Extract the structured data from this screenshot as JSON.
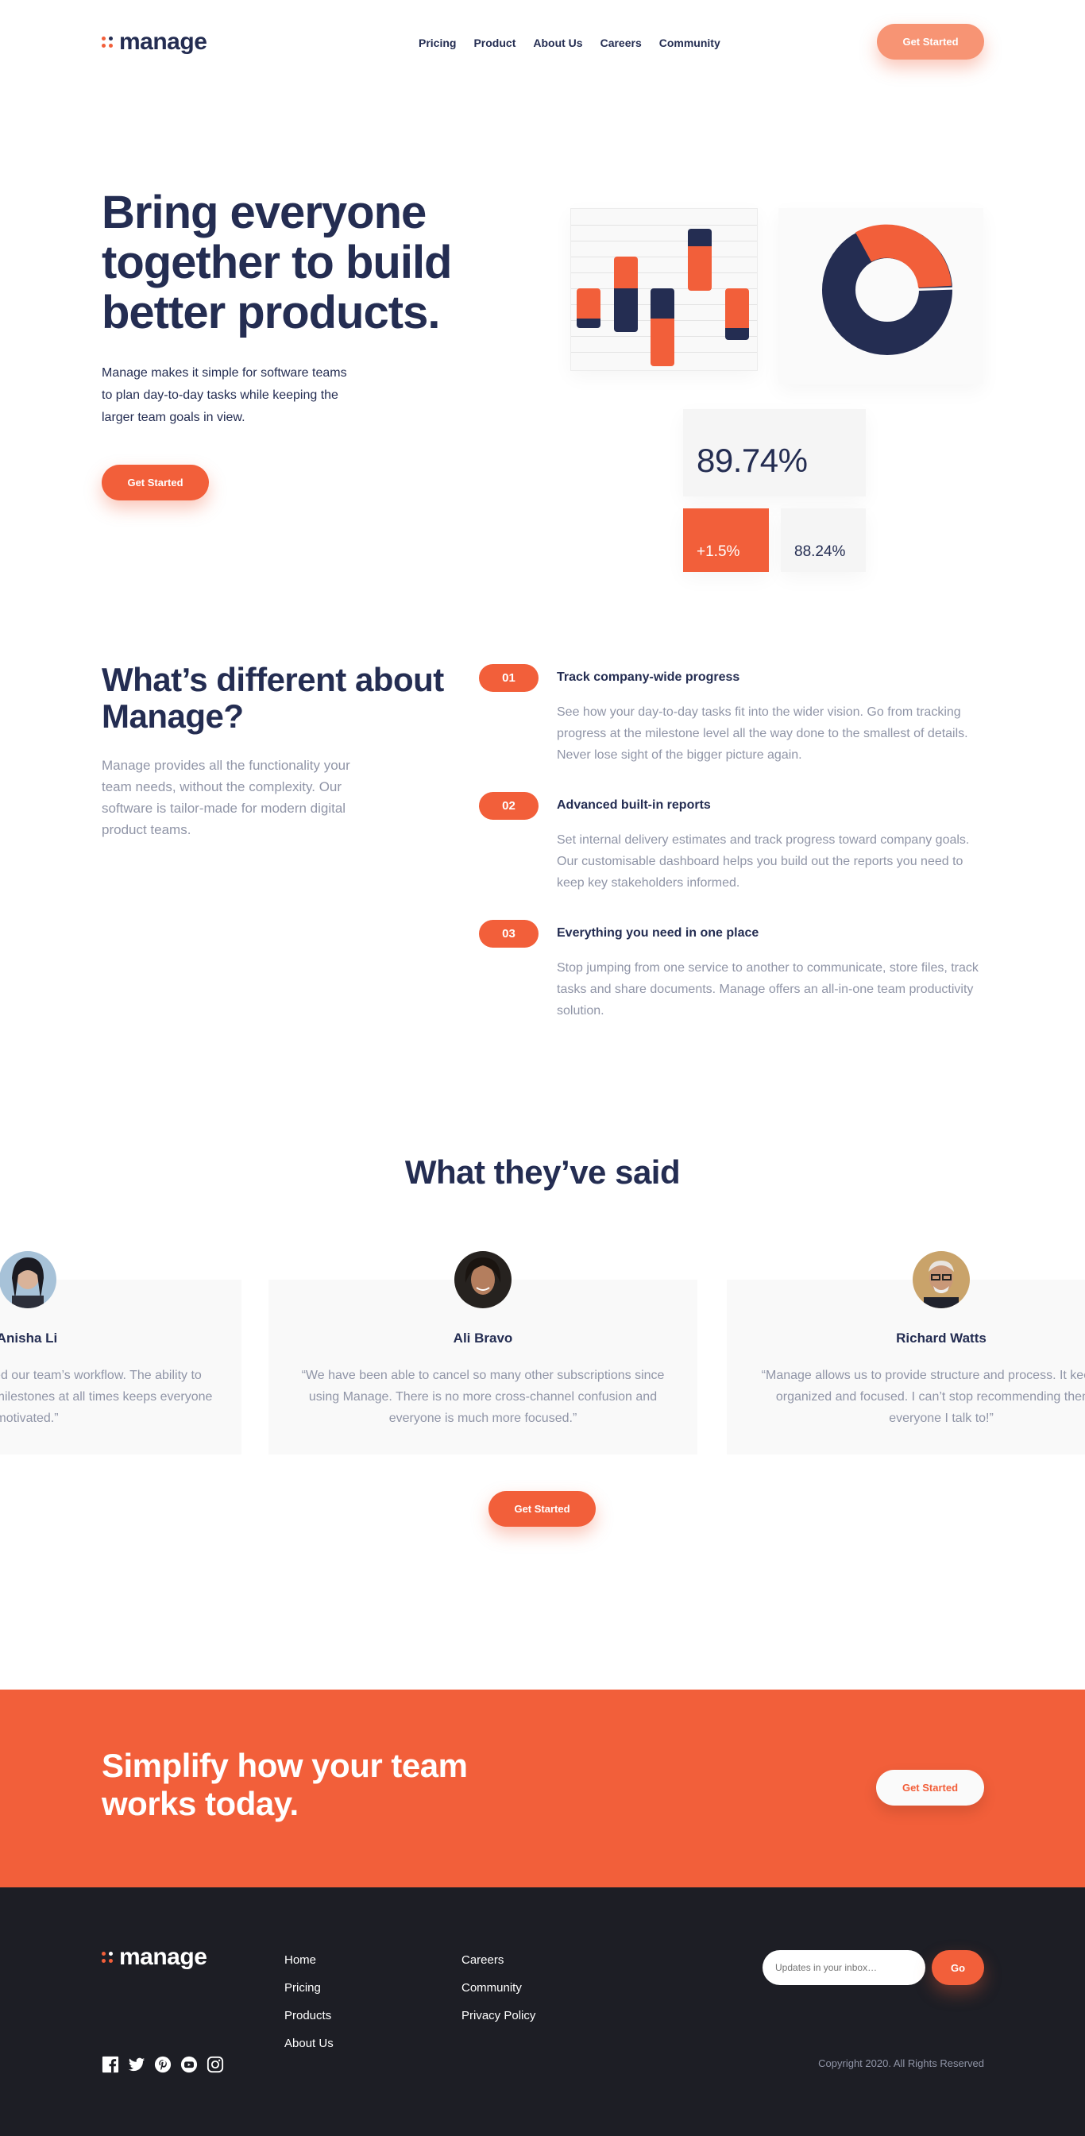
{
  "brand": {
    "name": "manage",
    "accent": "#f25f3a",
    "navy": "#242d52"
  },
  "nav": {
    "items": [
      "Pricing",
      "Product",
      "About Us",
      "Careers",
      "Community"
    ],
    "cta": "Get Started"
  },
  "hero": {
    "title": "Bring everyone together to build better products.",
    "description": "Manage makes it simple for software teams to plan day-to-day tasks while keeping the larger team goals in view.",
    "cta": "Get Started",
    "stats": {
      "main": "89.74%",
      "delta": "+1.5%",
      "secondary": "88.24%"
    }
  },
  "features": {
    "title": "What’s different about Manage?",
    "description": "Manage provides all the functionality your team needs, without the complexity. Our software is tailor-made for modern digital product teams.",
    "items": [
      {
        "num": "01",
        "title": "Track company-wide progress",
        "body": "See how your day-to-day tasks fit into the wider vision. Go from tracking progress at the milestone level all the way done to the smallest of details. Never lose sight of the bigger picture again."
      },
      {
        "num": "02",
        "title": "Advanced built-in reports",
        "body": "Set internal delivery estimates and track progress toward company goals. Our customisable dashboard helps you build out the reports you need to keep key stakeholders informed."
      },
      {
        "num": "03",
        "title": "Everything you need in one place",
        "body": "Stop jumping from one service to another to communicate, store files, track tasks and share documents. Manage offers an all-in-one team productivity solution."
      }
    ]
  },
  "testimonials": {
    "title": "What they’ve said",
    "items": [
      {
        "name": "Anisha Li",
        "quote": "“Manage has supercharged our team’s workflow. The ability to maintain visibility on larger milestones at all times keeps everyone motivated.”"
      },
      {
        "name": "Ali Bravo",
        "quote": "“We have been able to cancel so many other subscriptions since using Manage. There is no more cross-channel confusion and everyone is much more focused.”"
      },
      {
        "name": "Richard Watts",
        "quote": "“Manage allows us to provide structure and process. It keeps us organized and focused. I can’t stop recommending them to everyone I talk to!”"
      }
    ],
    "cta": "Get Started"
  },
  "cta_band": {
    "title": "Simplify how your team works today.",
    "button": "Get Started"
  },
  "footer": {
    "col1": [
      "Home",
      "Pricing",
      "Products",
      "About Us"
    ],
    "col2": [
      "Careers",
      "Community",
      "Privacy Policy"
    ],
    "subscribe": {
      "placeholder": "Updates in your inbox…",
      "button": "Go"
    },
    "socials": [
      "facebook-icon",
      "twitter-icon",
      "pinterest-icon",
      "youtube-icon",
      "instagram-icon"
    ],
    "copyright": "Copyright 2020. All Rights Reserved"
  }
}
